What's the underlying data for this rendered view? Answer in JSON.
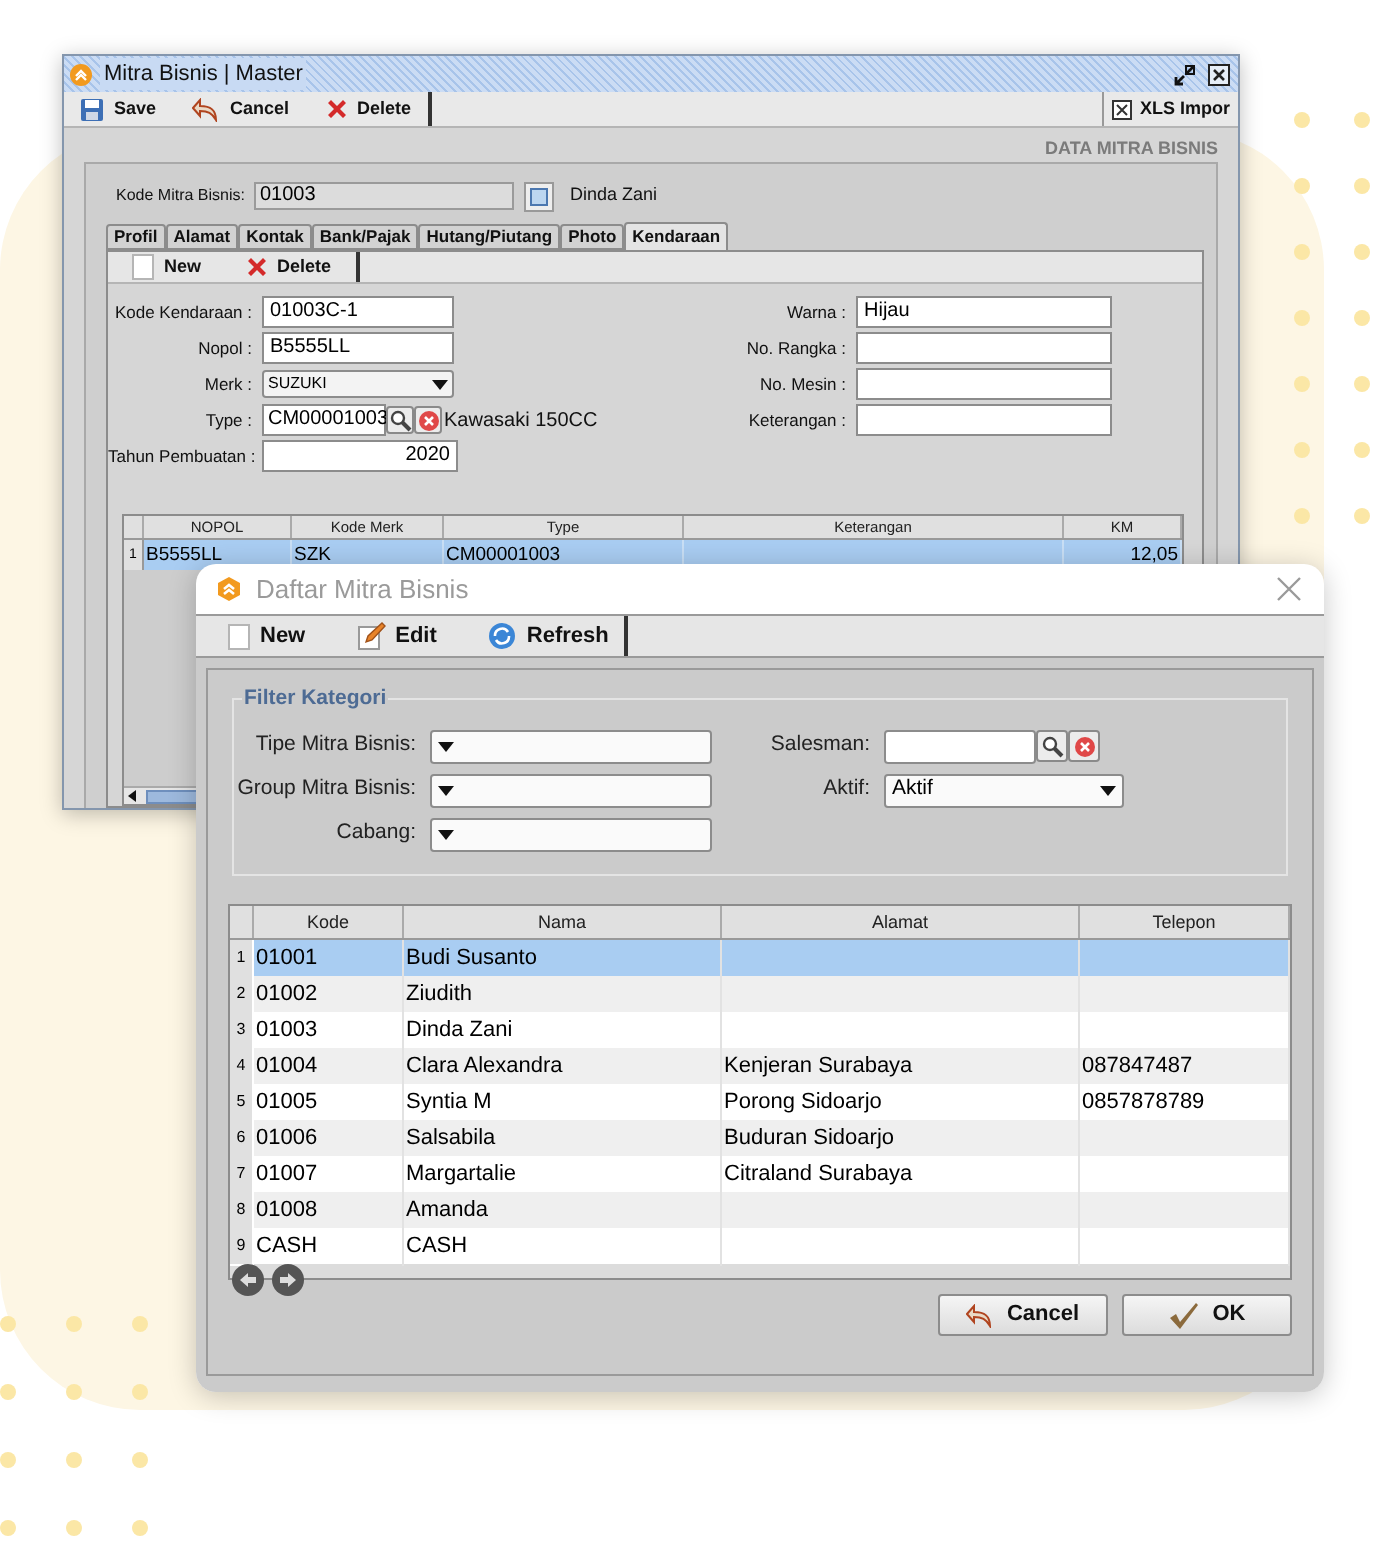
{
  "back_window": {
    "title": "Mitra Bisnis | Master",
    "toolbar": [
      {
        "kind": "save",
        "label": "Save"
      },
      {
        "kind": "cancel",
        "label": "Cancel"
      },
      {
        "kind": "delete",
        "label": "Delete"
      }
    ],
    "xls_button": "XLS Impor",
    "section_title": "DATA MITRA BISNIS",
    "kode_mitra": {
      "label": "Kode Mitra Bisnis:",
      "value": "01003",
      "name": "Dinda Zani"
    },
    "tabs": [
      {
        "label": "Profil",
        "selected": false
      },
      {
        "label": "Alamat",
        "selected": false
      },
      {
        "label": "Kontak",
        "selected": false
      },
      {
        "label": "Bank/Pajak",
        "selected": false
      },
      {
        "label": "Hutang/Piutang",
        "selected": false
      },
      {
        "label": "Photo",
        "selected": false
      },
      {
        "label": "Kendaraan",
        "selected": true
      }
    ],
    "sub_toolbar": [
      {
        "kind": "new",
        "label": "New"
      },
      {
        "kind": "delete",
        "label": "Delete"
      }
    ],
    "fields_left": [
      {
        "kind": "text",
        "label": "Kode Kendaraan :",
        "value": "01003C-1"
      },
      {
        "kind": "text",
        "label": "Nopol :",
        "value": "B5555LL"
      },
      {
        "kind": "select",
        "label": "Merk :",
        "value": "SUZUKI"
      },
      {
        "kind": "lookup",
        "label": "Type :",
        "value": "CM00001003",
        "description": "Kawasaki 150CC"
      },
      {
        "kind": "number",
        "label": "Tahun Pembuatan :",
        "value": "2020"
      }
    ],
    "fields_right": [
      {
        "kind": "text",
        "label": "Warna :",
        "value": "Hijau"
      },
      {
        "kind": "text",
        "label": "No. Rangka :"
      },
      {
        "kind": "text",
        "label": "No. Mesin :"
      },
      {
        "kind": "text",
        "label": "Keterangan :"
      }
    ],
    "grid": {
      "columns": [
        "NOPOL",
        "Kode Merk",
        "Type",
        "Keterangan",
        "KM"
      ],
      "rows": [
        {
          "number": "1",
          "selected": true,
          "cells": [
            "B5555LL",
            "SZK",
            "CM00001003",
            null,
            "12,05"
          ]
        }
      ]
    }
  },
  "dialog": {
    "title": "Daftar Mitra Bisnis",
    "toolbar": [
      {
        "kind": "new",
        "label": "New"
      },
      {
        "kind": "edit",
        "label": "Edit"
      },
      {
        "kind": "refresh",
        "label": "Refresh"
      }
    ],
    "filter": {
      "legend": "Filter Kategori",
      "left_fields": [
        {
          "kind": "select",
          "label": "Tipe Mitra Bisnis:"
        },
        {
          "kind": "select",
          "label": "Group Mitra Bisnis:"
        },
        {
          "kind": "select",
          "label": "Cabang:"
        }
      ],
      "right_fields": [
        {
          "kind": "lookup",
          "label": "Salesman:"
        },
        {
          "kind": "select",
          "label": "Aktif:",
          "value": "Aktif"
        }
      ]
    },
    "table": {
      "columns": [
        "Kode",
        "Nama",
        "Alamat",
        "Telepon"
      ],
      "rows": [
        {
          "number": "1",
          "selected": true,
          "cells": [
            "01001",
            "Budi Susanto",
            null,
            null
          ]
        },
        {
          "number": "2",
          "selected": false,
          "cells": [
            "01002",
            "Ziudith",
            null,
            null
          ]
        },
        {
          "number": "3",
          "selected": false,
          "cells": [
            "01003",
            "Dinda Zani",
            null,
            null
          ]
        },
        {
          "number": "4",
          "selected": false,
          "cells": [
            "01004",
            "Clara Alexandra",
            "Kenjeran Surabaya",
            "087847487"
          ]
        },
        {
          "number": "5",
          "selected": false,
          "cells": [
            "01005",
            "Syntia M",
            "Porong Sidoarjo",
            "0857878789"
          ]
        },
        {
          "number": "6",
          "selected": false,
          "cells": [
            "01006",
            "Salsabila",
            "Buduran Sidoarjo",
            null
          ]
        },
        {
          "number": "7",
          "selected": false,
          "cells": [
            "01007",
            "Margartalie",
            "Citraland Surabaya",
            null
          ]
        },
        {
          "number": "8",
          "selected": false,
          "cells": [
            "01008",
            "Amanda",
            null,
            null
          ]
        },
        {
          "number": "9",
          "selected": false,
          "cells": [
            "CASH",
            "CASH",
            null,
            null
          ]
        }
      ]
    },
    "buttons": [
      {
        "kind": "cancel",
        "label": "Cancel"
      },
      {
        "kind": "ok",
        "label": "OK"
      }
    ]
  }
}
